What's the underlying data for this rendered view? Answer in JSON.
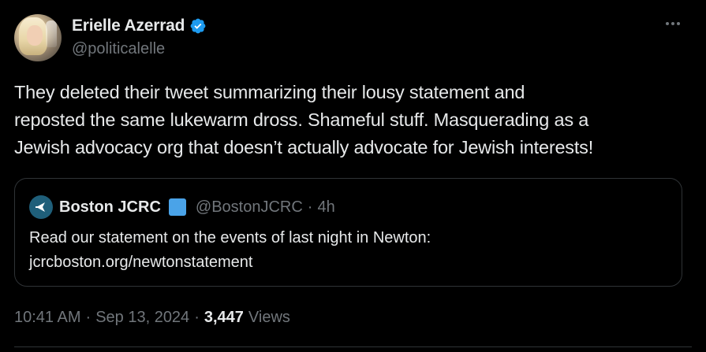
{
  "author": {
    "display_name": "Erielle Azerrad",
    "handle": "@politicalelle",
    "verified_icon": "verified-badge-icon"
  },
  "more_icon": "more-options-icon",
  "tweet": {
    "line1": "They deleted their tweet summarizing their lousy statement and",
    "line2": "reposted the same lukewarm dross. Shameful stuff. Masquerading as a",
    "line3": "Jewish advocacy org that doesn’t actually advocate for Jewish interests!"
  },
  "quoted": {
    "display_name": "Boston JCRC",
    "handle": "@BostonJCRC",
    "dot": "·",
    "time": "4h",
    "text_line1": "Read our statement on the events of last night in Newton:",
    "text_line2": "jcrcboston.org/newtonstatement",
    "badge_icon": "affiliation-badge-icon",
    "avatar_icon": "jcrc-logo-icon"
  },
  "meta": {
    "time": "10:41 AM",
    "sep1": "·",
    "date": "Sep 13, 2024",
    "sep2": "·",
    "views_count": "3,447",
    "views_label": "Views"
  },
  "colors": {
    "background": "#000000",
    "text_primary": "#e7e9ea",
    "text_secondary": "#71767b",
    "verified_blue": "#1d9bf0",
    "border": "#2f3336"
  }
}
